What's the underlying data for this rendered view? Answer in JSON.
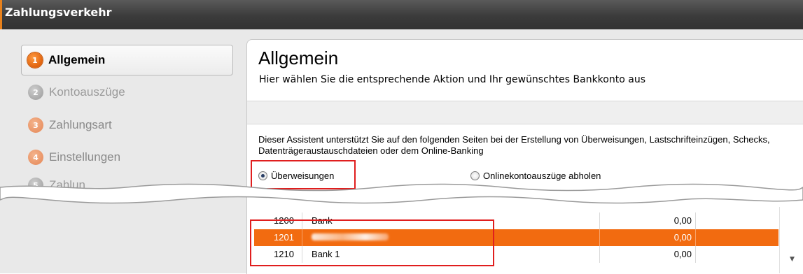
{
  "window": {
    "title": "Zahlungsverkehr"
  },
  "nav": {
    "items": [
      {
        "num": "1",
        "label": "Allgemein",
        "state": "active"
      },
      {
        "num": "2",
        "label": "Kontoauszüge",
        "state": "disabled"
      },
      {
        "num": "3",
        "label": "Zahlungsart",
        "state": "inactive"
      },
      {
        "num": "4",
        "label": "Einstellungen",
        "state": "inactive"
      },
      {
        "num": "5",
        "label": "Zahlun",
        "state": "disabled"
      }
    ]
  },
  "page": {
    "title": "Allgemein",
    "subtitle": "Hier wählen Sie die entsprechende Aktion und Ihr gewünschtes Bankkonto aus",
    "info": "Dieser Assistent unterstützt Sie auf den folgenden Seiten bei der Erstellung von Überweisungen, Lastschrifteinzügen, Schecks, Datenträgeraustauschdateien oder dem Online-Banking",
    "option1": "Überweisungen",
    "option2": "Onlinekontoauszüge abholen"
  },
  "accounts": {
    "rows": [
      {
        "acc": "1200",
        "name": "Bank",
        "amount": "0,00"
      },
      {
        "acc": "1201",
        "name": "",
        "amount": "0,00"
      },
      {
        "acc": "1210",
        "name": "Bank 1",
        "amount": "0,00"
      }
    ]
  },
  "colors": {
    "accent": "#f26b10",
    "highlight_box": "#e01e1e",
    "titlebar": "#3b3b3b"
  }
}
